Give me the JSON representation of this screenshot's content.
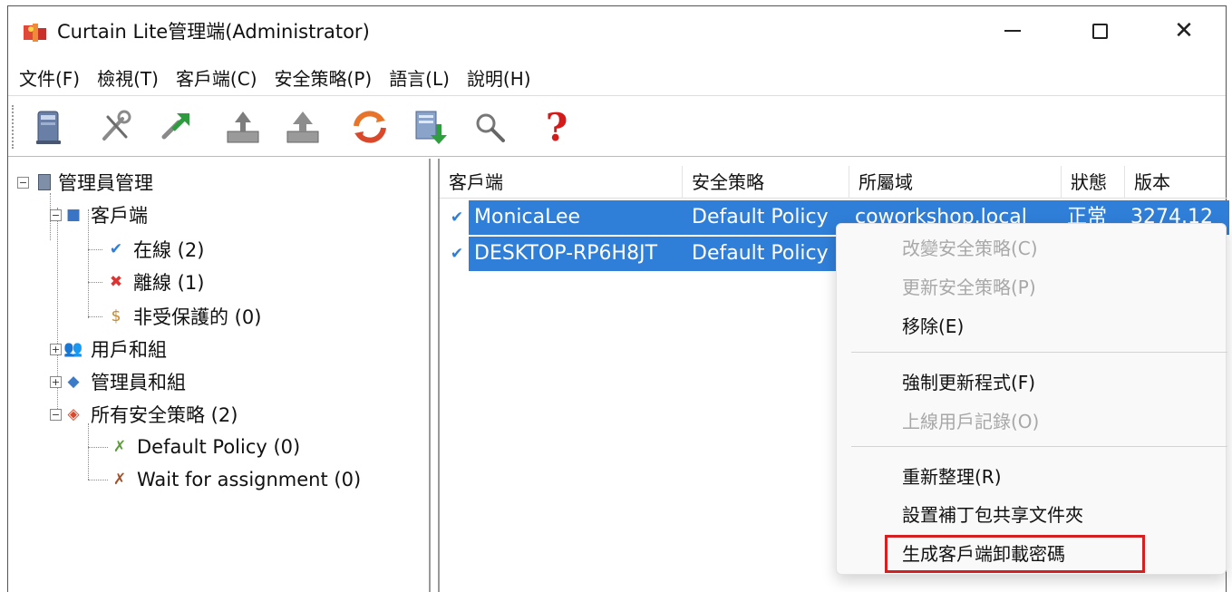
{
  "window": {
    "title": "Curtain Lite管理端(Administrator)",
    "controls": {
      "minimize": "—",
      "maximize": "☐",
      "close": "✕"
    }
  },
  "menu": [
    "文件(F)",
    "檢視(T)",
    "客戶端(C)",
    "安全策略(P)",
    "語言(L)",
    "說明(H)"
  ],
  "toolbar": {
    "buttons": [
      "server-icon",
      "tools-icon",
      "deploy-icon",
      "import-icon",
      "export-icon",
      "refresh-policy-icon",
      "update-icon",
      "search-icon",
      "help-icon"
    ],
    "help_glyph": "?"
  },
  "tree": {
    "root": "管理員管理",
    "clients": "客戶端",
    "online": "在線 (2)",
    "offline": "離線 (1)",
    "unprotected": "非受保護的 (0)",
    "users_groups": "用戶和組",
    "admins_groups": "管理員和組",
    "policies": "所有安全策略 (2)",
    "policy_default": "Default Policy (0)",
    "policy_wait": "Wait for assignment (0)"
  },
  "list": {
    "columns": [
      "客戶端",
      "安全策略",
      "所屬域",
      "狀態",
      "版本"
    ],
    "rows": [
      {
        "client": "MonicaLee",
        "policy": "Default Policy",
        "domain": "coworkshop.local",
        "status": "正常",
        "version": "3274.12"
      },
      {
        "client": "DESKTOP-RP6H8JT",
        "policy": "Default Policy",
        "domain": "",
        "status": "",
        "version": ""
      }
    ]
  },
  "context_menu": {
    "items": [
      {
        "label": "改變安全策略(C)",
        "enabled": false
      },
      {
        "label": "更新安全策略(P)",
        "enabled": false
      },
      {
        "label": "移除(E)",
        "enabled": true
      },
      {
        "label": "強制更新程式(F)",
        "enabled": true
      },
      {
        "label": "上線用戶記錄(O)",
        "enabled": false
      },
      {
        "label": "重新整理(R)",
        "enabled": true
      },
      {
        "label": "設置補丁包共享文件夾",
        "enabled": true
      },
      {
        "label": "生成客戶端卸載密碼",
        "enabled": true
      }
    ]
  },
  "colors": {
    "selection": "#2f7ed8",
    "highlight_box": "#d42020",
    "help": "#d51a1a"
  }
}
